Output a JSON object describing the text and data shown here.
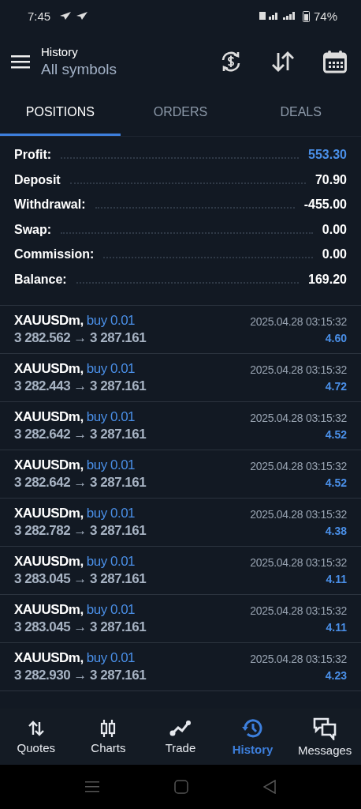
{
  "status_bar": {
    "time": "7:45",
    "battery": "74%"
  },
  "header": {
    "title": "History",
    "subtitle": "All symbols"
  },
  "tabs": [
    {
      "label": "POSITIONS",
      "selected": true
    },
    {
      "label": "ORDERS",
      "selected": false
    },
    {
      "label": "DEALS",
      "selected": false
    }
  ],
  "summary": [
    {
      "label": "Profit:",
      "value": "553.30",
      "color": "#4a8fe7"
    },
    {
      "label": "Deposit",
      "value": "70.90",
      "color": "#ffffff"
    },
    {
      "label": "Withdrawal:",
      "value": "-455.00",
      "color": "#ffffff"
    },
    {
      "label": "Swap:",
      "value": "0.00",
      "color": "#ffffff"
    },
    {
      "label": "Commission:",
      "value": "0.00",
      "color": "#ffffff"
    },
    {
      "label": "Balance:",
      "value": "169.20",
      "color": "#ffffff"
    }
  ],
  "positions": [
    {
      "symbol": "XAUUSDm,",
      "side": "buy 0.01",
      "prices": "3 282.562 → 3 287.161",
      "time": "2025.04.28 03:15:32",
      "profit": "4.60"
    },
    {
      "symbol": "XAUUSDm,",
      "side": "buy 0.01",
      "prices": "3 282.443 → 3 287.161",
      "time": "2025.04.28 03:15:32",
      "profit": "4.72"
    },
    {
      "symbol": "XAUUSDm,",
      "side": "buy 0.01",
      "prices": "3 282.642 → 3 287.161",
      "time": "2025.04.28 03:15:32",
      "profit": "4.52"
    },
    {
      "symbol": "XAUUSDm,",
      "side": "buy 0.01",
      "prices": "3 282.642 → 3 287.161",
      "time": "2025.04.28 03:15:32",
      "profit": "4.52"
    },
    {
      "symbol": "XAUUSDm,",
      "side": "buy 0.01",
      "prices": "3 282.782 → 3 287.161",
      "time": "2025.04.28 03:15:32",
      "profit": "4.38"
    },
    {
      "symbol": "XAUUSDm,",
      "side": "buy 0.01",
      "prices": "3 283.045 → 3 287.161",
      "time": "2025.04.28 03:15:32",
      "profit": "4.11"
    },
    {
      "symbol": "XAUUSDm,",
      "side": "buy 0.01",
      "prices": "3 283.045 → 3 287.161",
      "time": "2025.04.28 03:15:32",
      "profit": "4.11"
    },
    {
      "symbol": "XAUUSDm,",
      "side": "buy 0.01",
      "prices": "3 282.930 → 3 287.161",
      "time": "2025.04.28 03:15:32",
      "profit": "4.23"
    }
  ],
  "bottom_nav": [
    {
      "label": "Quotes",
      "kind": "quotes",
      "selected": false
    },
    {
      "label": "Charts",
      "kind": "charts",
      "selected": false
    },
    {
      "label": "Trade",
      "kind": "trade",
      "selected": false
    },
    {
      "label": "History",
      "kind": "history",
      "selected": true
    },
    {
      "label": "Messages",
      "kind": "messages",
      "selected": false
    }
  ]
}
